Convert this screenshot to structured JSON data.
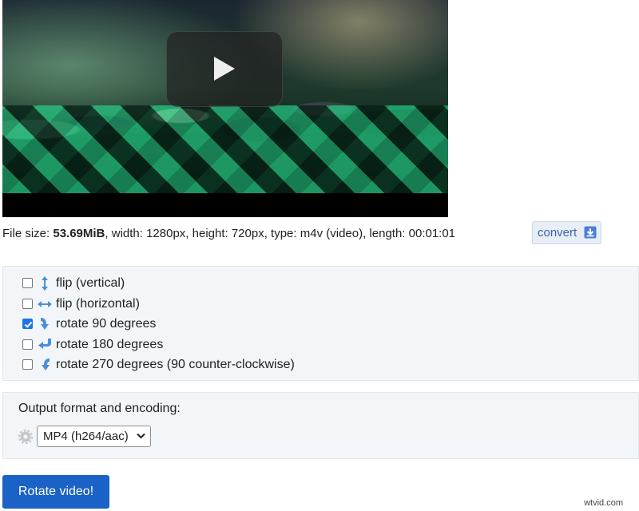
{
  "video": {
    "play_icon": "play-icon"
  },
  "file_info": {
    "size_label": "File size: ",
    "size_value": "53.69MiB",
    "rest": ", width: 1280px, height: 720px, type: m4v (video), length: 00:01:01",
    "convert_label": "convert",
    "convert_icon": "download-arrow-icon"
  },
  "options": [
    {
      "label": "flip (vertical)",
      "checked": false,
      "icon": "vertical-arrow-icon"
    },
    {
      "label": "flip (horizontal)",
      "checked": false,
      "icon": "horizontal-arrow-icon"
    },
    {
      "label": "rotate 90 degrees",
      "checked": true,
      "icon": "rotate-down-arrow-icon"
    },
    {
      "label": "rotate 180 degrees",
      "checked": false,
      "icon": "rotate-left-arrow-icon"
    },
    {
      "label": "rotate 270 degrees (90 counter-clockwise)",
      "checked": false,
      "icon": "rotate-down-left-arrow-icon"
    }
  ],
  "output": {
    "label": "Output format and encoding:",
    "selected": "MP4 (h264/aac)",
    "icon": "gear-icon"
  },
  "submit_label": "Rotate video!",
  "watermark": "wtvid.com",
  "colors": {
    "accent": "#1a62c5",
    "panel_bg": "#f3f6f9",
    "icon_blue": "#4a90d9"
  }
}
